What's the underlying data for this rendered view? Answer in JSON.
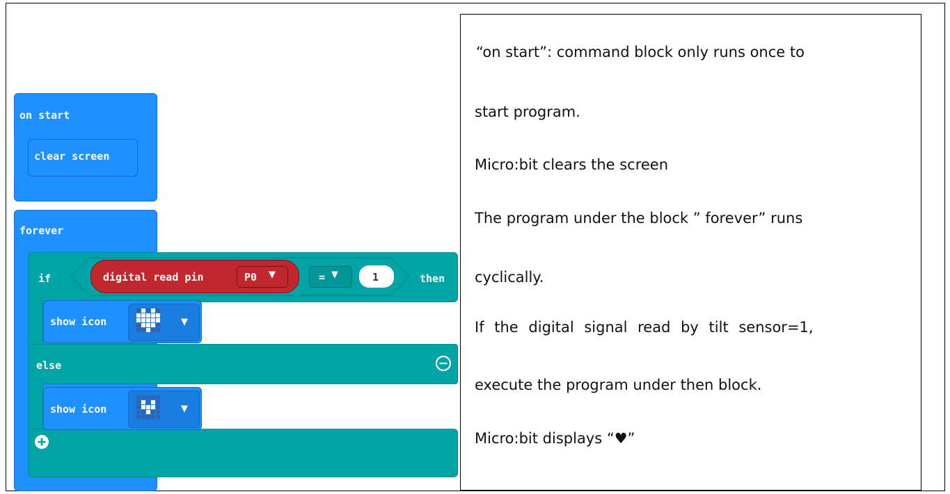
{
  "blocks": {
    "on_start": {
      "label": "on start",
      "child": "clear screen"
    },
    "forever": {
      "label": "forever",
      "if_label": "if",
      "condition": {
        "left": "digital read pin",
        "pin": "P0",
        "operator": "=",
        "value": "1"
      },
      "then_label": "then",
      "then_body": "show icon",
      "else_label": "else",
      "else_body": "show icon"
    },
    "icons": {
      "heart_big": [
        0,
        1,
        0,
        1,
        0,
        1,
        1,
        1,
        1,
        1,
        1,
        1,
        1,
        1,
        1,
        0,
        1,
        1,
        1,
        0,
        0,
        0,
        1,
        0,
        0
      ],
      "heart_small": [
        0,
        0,
        0,
        0,
        0,
        0,
        1,
        0,
        1,
        0,
        0,
        1,
        1,
        1,
        0,
        0,
        0,
        1,
        0,
        0,
        0,
        0,
        0,
        0,
        0
      ]
    },
    "colors": {
      "basic": "#1e90ff",
      "logic": "#00a4a6",
      "pins": "#c1272d"
    }
  },
  "description": {
    "lines": [
      "“on start”: command block only runs once to",
      "start program.",
      "Micro:bit clears the screen",
      "The program under the block ” forever” runs",
      "cyclically.",
      "If the digital signal read by tilt sensor=1,",
      "execute the program under then block.",
      "Micro:bit displays “♥”"
    ]
  }
}
